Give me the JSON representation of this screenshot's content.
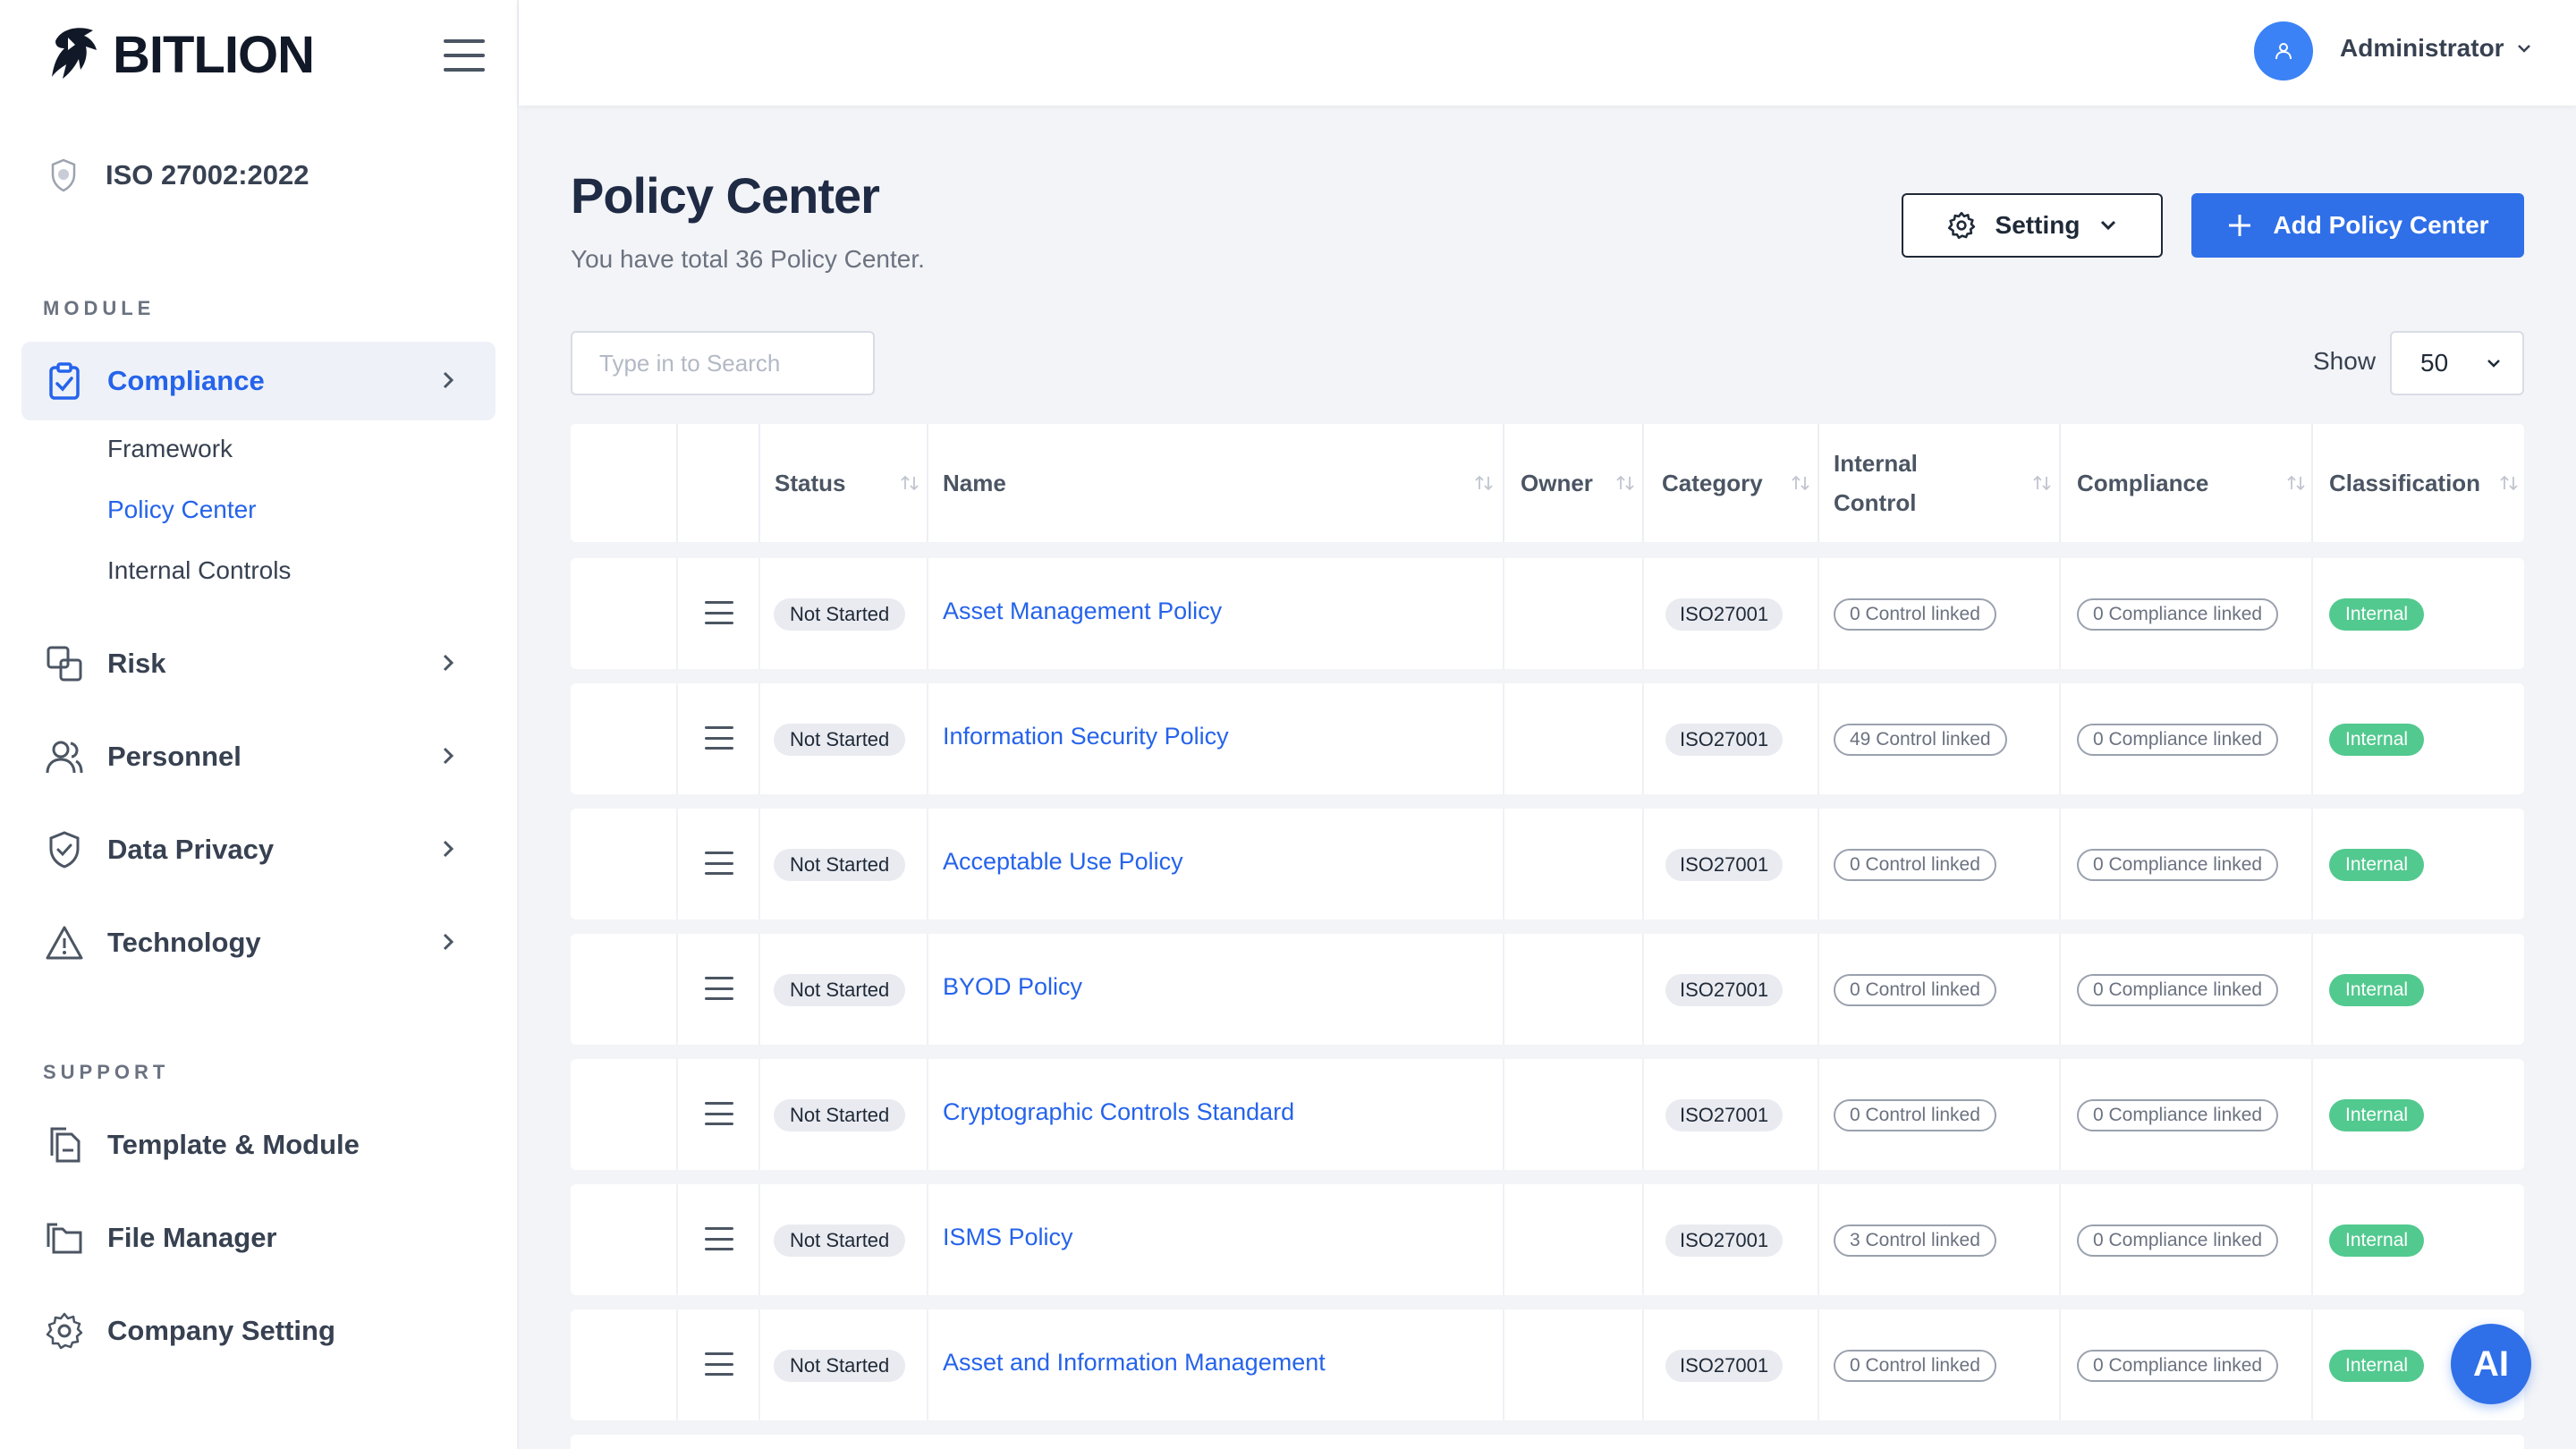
{
  "brand": {
    "name": "BITLION"
  },
  "framework": {
    "label": "ISO 27002:2022"
  },
  "sidebar": {
    "module_label": "MODULE",
    "support_label": "SUPPORT",
    "compliance": "Compliance",
    "compliance_sub": [
      "Framework",
      "Policy Center",
      "Internal Controls"
    ],
    "risk": "Risk",
    "personnel": "Personnel",
    "data_privacy": "Data Privacy",
    "technology": "Technology",
    "template_module": "Template & Module",
    "file_manager": "File Manager",
    "company_setting": "Company Setting"
  },
  "header": {
    "user": "Administrator"
  },
  "page": {
    "title": "Policy Center",
    "subtitle": "You have total 36 Policy Center.",
    "setting_label": "Setting",
    "add_label": "Add Policy Center",
    "search_placeholder": "Type in to Search",
    "show_label": "Show",
    "show_value": "50"
  },
  "table": {
    "headers": {
      "status": "Status",
      "name": "Name",
      "owner": "Owner",
      "category": "Category",
      "internal_control_1": "Internal",
      "internal_control_2": "Control",
      "compliance": "Compliance",
      "classification": "Classification"
    },
    "rows": [
      {
        "status": "Not Started",
        "name": "Asset Management Policy",
        "category": "ISO27001",
        "controls": "0 Control linked",
        "compliance": "0 Compliance linked",
        "classification": "Internal"
      },
      {
        "status": "Not Started",
        "name": "Information Security Policy",
        "category": "ISO27001",
        "controls": "49 Control linked",
        "compliance": "0 Compliance linked",
        "classification": "Internal"
      },
      {
        "status": "Not Started",
        "name": "Acceptable Use Policy",
        "category": "ISO27001",
        "controls": "0 Control linked",
        "compliance": "0 Compliance linked",
        "classification": "Internal"
      },
      {
        "status": "Not Started",
        "name": "BYOD Policy",
        "category": "ISO27001",
        "controls": "0 Control linked",
        "compliance": "0 Compliance linked",
        "classification": "Internal"
      },
      {
        "status": "Not Started",
        "name": "Cryptographic Controls Standard",
        "category": "ISO27001",
        "controls": "0 Control linked",
        "compliance": "0 Compliance linked",
        "classification": "Internal"
      },
      {
        "status": "Not Started",
        "name": "ISMS Policy",
        "category": "ISO27001",
        "controls": "3 Control linked",
        "compliance": "0 Compliance linked",
        "classification": "Internal"
      },
      {
        "status": "Not Started",
        "name": "Asset and Information Management",
        "category": "ISO27001",
        "controls": "0 Control linked",
        "compliance": "0 Compliance linked",
        "classification": "Internal"
      }
    ]
  },
  "ai_button": "AI",
  "colors": {
    "accent": "#2f6fe8",
    "link": "#2563eb",
    "internal_badge": "#52c98f",
    "avatar": "#3b82f6"
  }
}
